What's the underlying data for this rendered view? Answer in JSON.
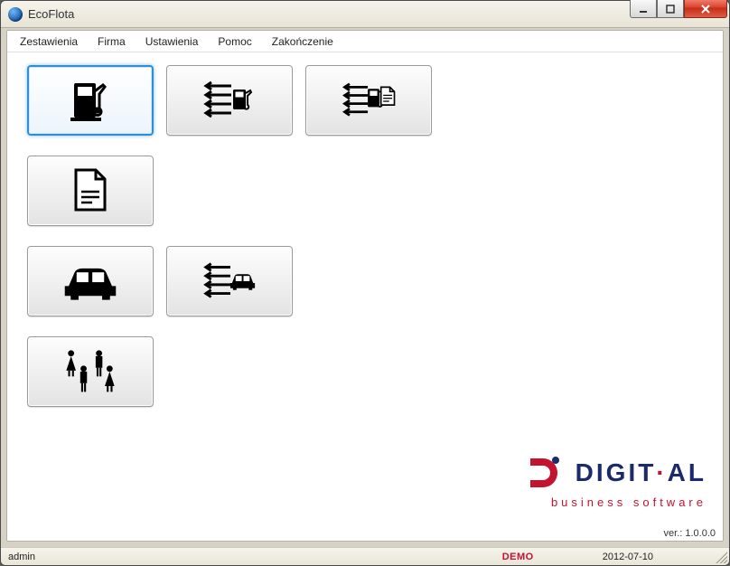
{
  "window": {
    "title": "EcoFlota"
  },
  "menu": {
    "items": [
      "Zestawienia",
      "Firma",
      "Ustawienia",
      "Pomoc",
      "Zakończenie"
    ]
  },
  "tiles": {
    "row1": [
      {
        "name": "fuel-button",
        "icon": "fuel-pump-icon",
        "selected": true
      },
      {
        "name": "fuel-list-button",
        "icon": "fuel-list-icon",
        "selected": false
      },
      {
        "name": "fuel-doc-list-button",
        "icon": "fuel-doc-list-icon",
        "selected": false
      }
    ],
    "row2": [
      {
        "name": "document-button",
        "icon": "document-icon",
        "selected": false
      }
    ],
    "row3": [
      {
        "name": "car-button",
        "icon": "car-icon",
        "selected": false
      },
      {
        "name": "car-list-button",
        "icon": "car-list-icon",
        "selected": false
      }
    ],
    "row4": [
      {
        "name": "people-button",
        "icon": "people-icon",
        "selected": false
      }
    ]
  },
  "brand": {
    "name_part1": "DIGIT",
    "name_part2": "AL",
    "subtitle": "business software"
  },
  "version": {
    "label": "ver.: 1.0.0.0"
  },
  "status": {
    "user": "admin",
    "mode": "DEMO",
    "date": "2012-07-10"
  }
}
